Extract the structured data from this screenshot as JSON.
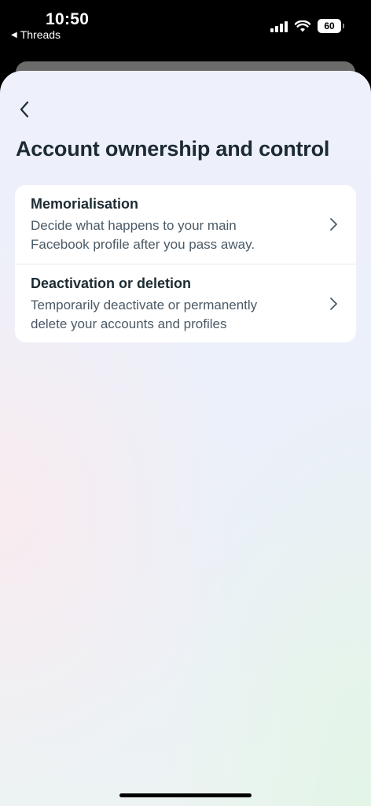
{
  "status_bar": {
    "time": "10:50",
    "back_app": "Threads",
    "battery": "60"
  },
  "page": {
    "title": "Account ownership and control"
  },
  "options": [
    {
      "title": "Memorialisation",
      "description_line1": "Decide what happens to your main",
      "description_line2": "Facebook profile after you pass away."
    },
    {
      "title": "Deactivation or deletion",
      "description_line1": "Temporarily deactivate or permanently",
      "description_line2": "delete your accounts and profiles"
    }
  ],
  "icons": {
    "back": "chevron-left-icon",
    "row_arrow": "chevron-right-icon",
    "signal": "cellular-signal-icon",
    "wifi": "wifi-icon",
    "battery": "battery-icon"
  },
  "colors": {
    "text_primary": "#1c2b33",
    "text_secondary": "#4b5a66",
    "card_bg": "#ffffff"
  }
}
